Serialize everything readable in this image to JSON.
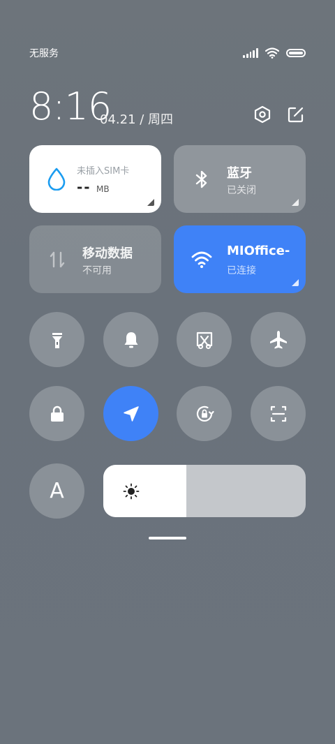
{
  "status_bar": {
    "carrier": "无服务"
  },
  "header": {
    "time": "8:16",
    "date": "04.21 / 周四"
  },
  "tiles": {
    "sim": {
      "title": "未插入SIM卡",
      "value": "--",
      "unit": "MB"
    },
    "bluetooth": {
      "title": "蓝牙",
      "status": "已关闭"
    },
    "mobile_data": {
      "title": "移动数据",
      "status": "不可用"
    },
    "wifi": {
      "title": "MIOffice-",
      "status": "已连接"
    }
  },
  "font_button": {
    "label": "A"
  },
  "brightness": {
    "level": 0.41
  },
  "colors": {
    "accent": "#3f82f7",
    "sim_icon": "#1a9cf0"
  },
  "icons": [
    "signal-icon",
    "wifi-icon",
    "battery-icon",
    "settings-icon",
    "edit-icon",
    "water-drop-icon",
    "bluetooth-icon",
    "mobile-data-icon",
    "flashlight-icon",
    "bell-icon",
    "screenshot-icon",
    "airplane-icon",
    "lock-icon",
    "location-icon",
    "rotation-lock-icon",
    "scan-icon",
    "brightness-icon"
  ]
}
